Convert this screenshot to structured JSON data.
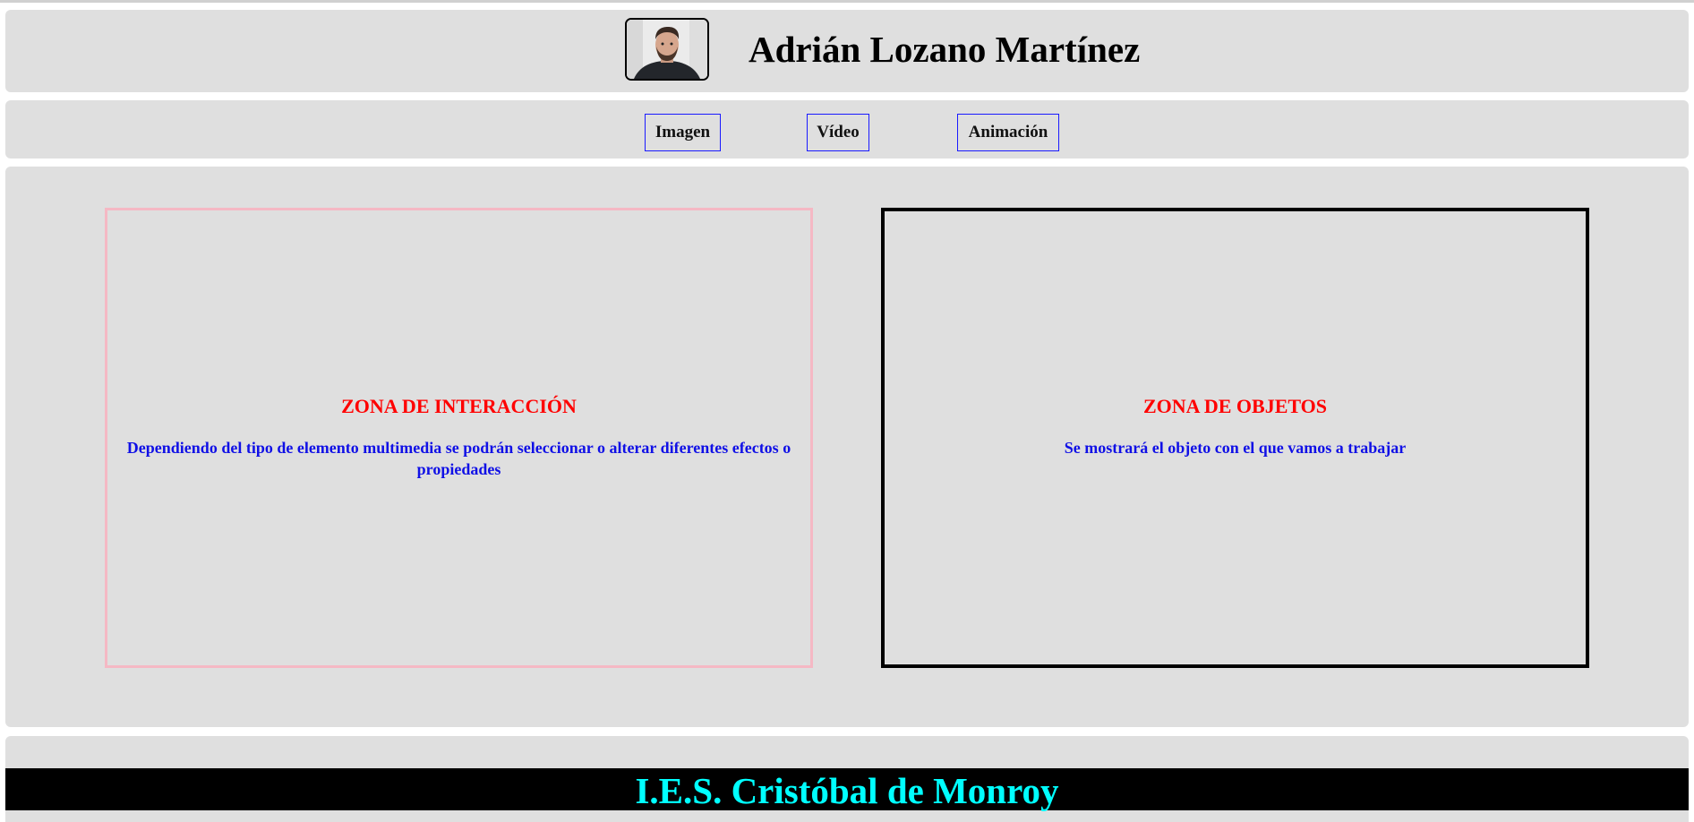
{
  "header": {
    "avatar_alt": "Foto de perfil",
    "name": "Adrián Lozano Martínez"
  },
  "nav": {
    "items": [
      {
        "label": "Imagen"
      },
      {
        "label": "Vídeo"
      },
      {
        "label": "Animación"
      }
    ]
  },
  "main": {
    "interaction": {
      "title": "ZONA DE INTERACCIÓN",
      "description": "Dependiendo del tipo de elemento multimedia se podrán seleccionar o alterar diferentes efectos o propiedades"
    },
    "objects": {
      "title": "ZONA DE OBJETOS",
      "description": "Se mostrará el objeto con el que vamos a trabajar"
    }
  },
  "footer": {
    "school": "I.E.S. Cristóbal de Monroy"
  },
  "colors": {
    "panel_bg": "#dfdfdf",
    "title_red": "#ff0000",
    "desc_blue": "#1010e6",
    "nav_border": "#1a1aff",
    "interaction_border": "#f5b8c4",
    "footer_bg": "#000000",
    "footer_text": "#00ffff"
  }
}
